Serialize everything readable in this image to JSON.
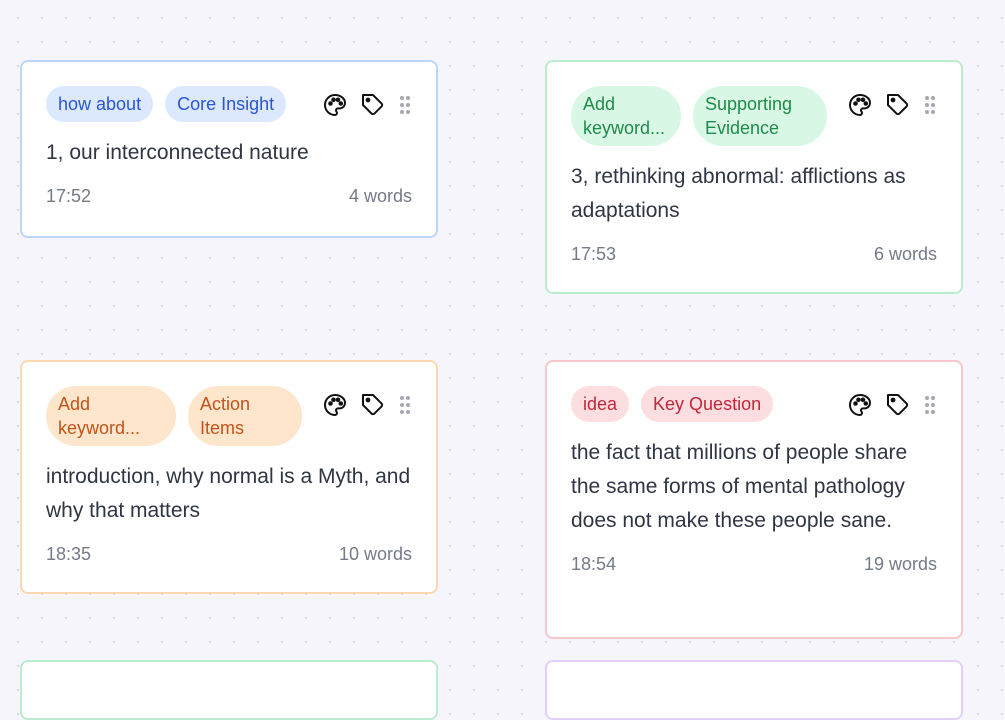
{
  "cards": [
    {
      "tags": [
        "how about",
        "Core Insight"
      ],
      "text": "1, our interconnected nature",
      "time": "17:52",
      "words": "4 words",
      "color": "#bcd6fb"
    },
    {
      "tags": [
        "Add keyword...",
        "Supporting Evidence"
      ],
      "text": "3, rethinking abnormal: afflictions as adaptations",
      "time": "17:53",
      "words": "6 words",
      "color": "#b9edcd"
    },
    {
      "tags": [
        "Add keyword...",
        "Action Items"
      ],
      "text": "introduction, why normal is a Myth, and why that matters",
      "time": "18:35",
      "words": "10 words",
      "color": "#fbd8b0"
    },
    {
      "tags": [
        "idea",
        "Key Question"
      ],
      "text": "the fact that millions of people share the same forms of mental pathology does not make these people sane.",
      "time": "18:54",
      "words": "19 words",
      "color": "#f8c6cb"
    }
  ],
  "partial_cards": [
    {
      "color": "#b9edcd"
    },
    {
      "color": "#e2d0f9"
    }
  ],
  "icons": {
    "palette": "palette-icon",
    "tag": "tag-icon",
    "drag": "drag-handle-icon"
  }
}
